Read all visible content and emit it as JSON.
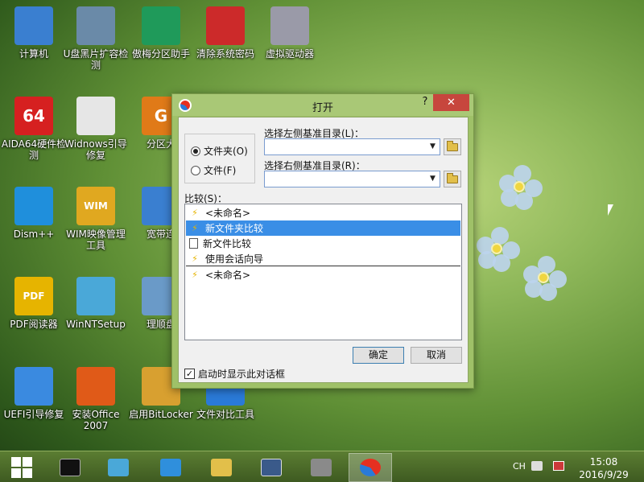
{
  "desktop": {
    "icons": [
      {
        "label": "计算机",
        "icon": "computer-icon",
        "color": "#3a7fd0"
      },
      {
        "label": "U盘黑片扩容检测",
        "icon": "magnifier-icon",
        "color": "#6a8aa8"
      },
      {
        "label": "傲梅分区助手",
        "icon": "partition-icon",
        "color": "#1f9a5a"
      },
      {
        "label": "清除系统密码",
        "icon": "key-icon",
        "color": "#cc2a2a"
      },
      {
        "label": "虚拟驱动器",
        "icon": "disc-icon",
        "color": "#9a9aa8"
      },
      {
        "label": "AIDA64硬件检测",
        "icon": "aida64-icon",
        "color": "#d62020",
        "text": "64"
      },
      {
        "label": "Widnows引导修复",
        "icon": "toolbox-icon",
        "color": "#e6e6e6"
      },
      {
        "label": "分区大",
        "icon": "partition-master-icon",
        "color": "#e07a18",
        "text": "G"
      },
      {
        "label": "Dism++",
        "icon": "gears-icon",
        "color": "#1f8fdc"
      },
      {
        "label": "WIM映像管理工具",
        "icon": "wim-icon",
        "color": "#e0a820",
        "text": "WIM"
      },
      {
        "label": "宽带连",
        "icon": "network-icon",
        "color": "#3a7fd0"
      },
      {
        "label": "PDF阅读器",
        "icon": "pdf-icon",
        "color": "#e6b400",
        "text": "PDF"
      },
      {
        "label": "WinNTSetup",
        "icon": "setup-icon",
        "color": "#4aa8d8"
      },
      {
        "label": "理顺盘",
        "icon": "drive-icon",
        "color": "#6a9ac8"
      },
      {
        "label": "UEFI引导修复",
        "icon": "uefi-icon",
        "color": "#3a8ae0"
      },
      {
        "label": "安装Office 2007",
        "icon": "office-icon",
        "color": "#e05a18"
      },
      {
        "label": "启用BitLocker",
        "icon": "bitlocker-icon",
        "color": "#d8a030"
      },
      {
        "label": "文件对比工具",
        "icon": "compare-icon",
        "color": "#2a7ad8"
      }
    ]
  },
  "dialog": {
    "title": "打开",
    "help_label": "?",
    "close_label": "✕",
    "radio_folder_label": "文件夹(O)",
    "radio_file_label": "文件(F)",
    "radio_selected": "folder",
    "left_dir_label": "选择左侧基准目录(L)：",
    "left_dir_value": "",
    "right_dir_label": "选择右侧基准目录(R)：",
    "right_dir_value": "",
    "compare_label": "比较(S)：",
    "list_items": [
      {
        "label": "<未命名>",
        "icon": "lightning-icon",
        "selected": false
      },
      {
        "label": "新文件夹比较",
        "icon": "folder-compare-icon",
        "selected": true
      },
      {
        "label": "新文件比较",
        "icon": "file-compare-icon",
        "selected": false
      },
      {
        "label": "使用会话向导",
        "icon": "wizard-icon",
        "selected": false
      },
      {
        "label": "<未命名>",
        "icon": "lightning-icon",
        "selected": false
      }
    ],
    "ok_label": "确定",
    "cancel_label": "取消",
    "startup_checkbox_label": "启动时显示此对话框",
    "startup_checked": true,
    "checkmark": "✓"
  },
  "taskbar": {
    "ime_label": "CH",
    "time": "15:08",
    "date": "2016/9/29"
  }
}
